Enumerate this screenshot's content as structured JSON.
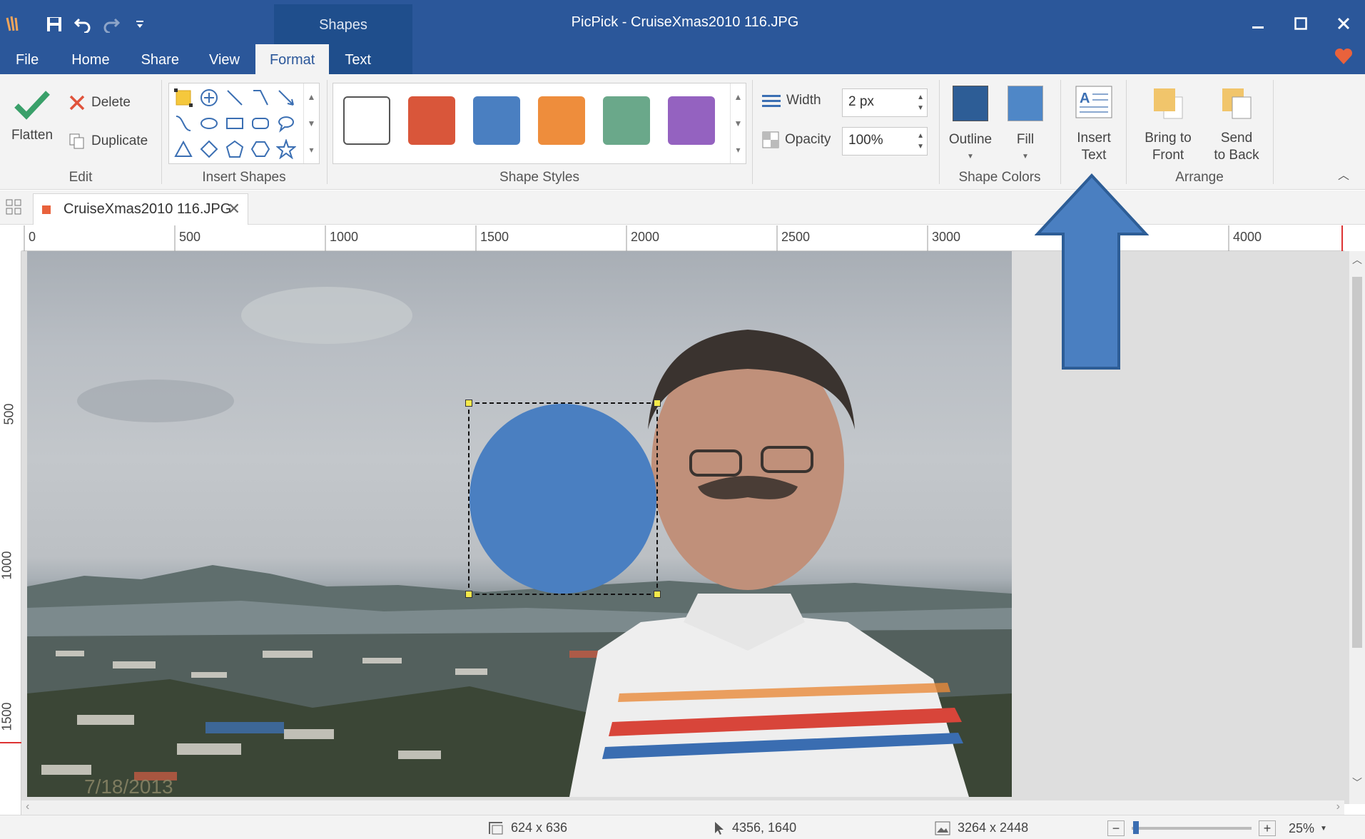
{
  "app": {
    "window_title": "PicPick - CruiseXmas2010 116.JPG",
    "context_tab_label": "Shapes"
  },
  "tabs": [
    {
      "label": "File"
    },
    {
      "label": "Home"
    },
    {
      "label": "Share"
    },
    {
      "label": "View"
    },
    {
      "label": "Format",
      "active": true
    },
    {
      "label": "Text"
    }
  ],
  "ribbon": {
    "edit": {
      "group_label": "Edit",
      "flatten": "Flatten",
      "delete": "Delete",
      "duplicate": "Duplicate"
    },
    "insert_shapes": {
      "group_label": "Insert Shapes",
      "shapes": [
        "select",
        "crosshair",
        "line",
        "elbow-connector",
        "arrow-line",
        "curved-connector",
        "ellipse",
        "rectangle",
        "rounded-rectangle",
        "speech-bubble",
        "triangle",
        "diamond",
        "pentagon",
        "hexagon",
        "star"
      ]
    },
    "shape_styles": {
      "group_label": "Shape Styles",
      "swatches": [
        "#ffffff",
        "#d9563a",
        "#4a7fc1",
        "#ee8d3c",
        "#6aa88a",
        "#9462c0"
      ]
    },
    "outline_width": {
      "label": "Width",
      "value": "2 px"
    },
    "opacity": {
      "label": "Opacity",
      "value": "100%"
    },
    "shape_colors": {
      "group_label": "Shape Colors",
      "outline": "Outline",
      "fill": "Fill",
      "outline_color": "#2d5d96",
      "fill_color": "#4f87c7"
    },
    "insert_text": {
      "line1": "Insert",
      "line2": "Text"
    },
    "arrange": {
      "group_label": "Arrange",
      "bring_front_1": "Bring to",
      "bring_front_2": "Front",
      "send_back_1": "Send",
      "send_back_2": "to Back"
    }
  },
  "document_tab": {
    "label": "CruiseXmas2010 116.JPG"
  },
  "rulers": {
    "horizontal": [
      "0",
      "500",
      "1000",
      "1500",
      "2000",
      "2500",
      "3000",
      "4000"
    ],
    "vertical": [
      "500",
      "1000",
      "1500"
    ]
  },
  "canvas": {
    "photo_date_stamp": "7/18/2013",
    "selected_shape": {
      "type": "circle",
      "fill": "#4a7fc1"
    }
  },
  "status": {
    "selection_size": "624 x 636",
    "cursor_pos": "4356, 1640",
    "image_size": "3264 x 2448",
    "zoom": "25%",
    "zoom_level": 0.25
  }
}
